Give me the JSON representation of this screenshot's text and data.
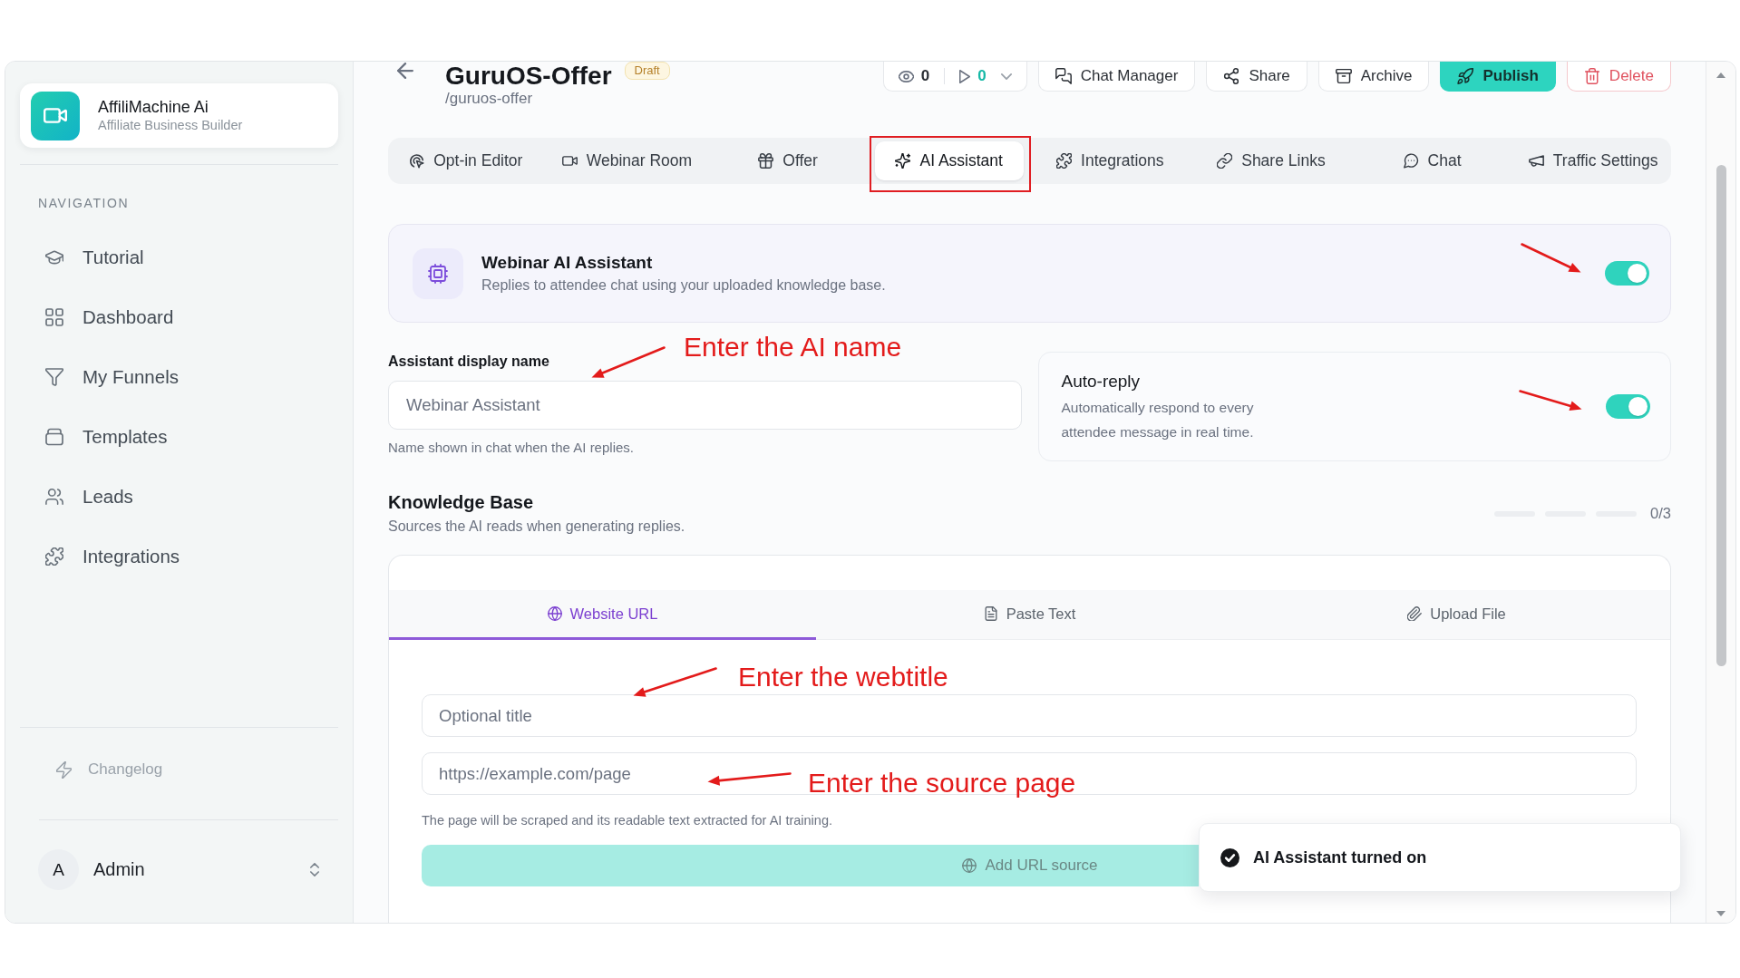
{
  "sidebar": {
    "brand": {
      "name": "AffiliMachine Ai",
      "tagline": "Affiliate Business Builder"
    },
    "section_label": "NAVIGATION",
    "items": [
      {
        "label": "Tutorial",
        "selected": false
      },
      {
        "label": "Dashboard",
        "selected": false
      },
      {
        "label": "My Funnels",
        "selected": false
      },
      {
        "label": "Templates",
        "selected": false
      },
      {
        "label": "Leads",
        "selected": false
      },
      {
        "label": "Integrations",
        "selected": false
      }
    ],
    "changelog": "Changelog",
    "user": {
      "initial": "A",
      "name": "Admin"
    }
  },
  "header": {
    "title": "GuruOS-Offer",
    "status": "Draft",
    "slug": "/guruos-offer",
    "views": "0",
    "plays": "0",
    "actions": [
      {
        "label": "Chat Manager",
        "kind": "default"
      },
      {
        "label": "Share",
        "kind": "default"
      },
      {
        "label": "Archive",
        "kind": "default"
      },
      {
        "label": "Publish",
        "kind": "primary"
      },
      {
        "label": "Delete",
        "kind": "danger"
      }
    ]
  },
  "tabs": [
    {
      "label": "Opt-in Editor",
      "selected": false,
      "highlighted": false
    },
    {
      "label": "Webinar Room",
      "selected": false,
      "highlighted": false
    },
    {
      "label": "Offer",
      "selected": false,
      "highlighted": false
    },
    {
      "label": "AI Assistant",
      "selected": true,
      "highlighted": true
    },
    {
      "label": "Integrations",
      "selected": false,
      "highlighted": false
    },
    {
      "label": "Share Links",
      "selected": false,
      "highlighted": false
    },
    {
      "label": "Chat",
      "selected": false,
      "highlighted": false
    },
    {
      "label": "Traffic Settings",
      "selected": false,
      "highlighted": false
    }
  ],
  "assistant": {
    "title": "Webinar AI Assistant",
    "description": "Replies to attendee chat using your uploaded knowledge base.",
    "on": true
  },
  "display_name": {
    "label": "Assistant display name",
    "placeholder": "Webinar Assistant",
    "hint": "Name shown in chat when the AI replies."
  },
  "auto_reply": {
    "title": "Auto-reply",
    "description": "Automatically respond to every attendee message in real time.",
    "on": true
  },
  "knowledge_base": {
    "title": "Knowledge Base",
    "subtitle": "Sources the AI reads when generating replies.",
    "slots": [
      {
        "filled": false
      },
      {
        "filled": false
      },
      {
        "filled": false
      }
    ],
    "count": "0/3",
    "source_tabs": [
      {
        "label": "Website URL",
        "selected": true
      },
      {
        "label": "Paste Text",
        "selected": false
      },
      {
        "label": "Upload File",
        "selected": false
      }
    ],
    "title_field": {
      "placeholder": "Optional title"
    },
    "url_field": {
      "placeholder": "https://example.com/page"
    },
    "hint": "The page will be scraped and its readable text extracted for AI training.",
    "add_button": {
      "label": "Add URL source",
      "disabled": true
    }
  },
  "toast": {
    "message": "AI Assistant turned on"
  },
  "annotations": [
    {
      "text": "Enter the AI name"
    },
    {
      "text": "Enter the webtitle"
    },
    {
      "text": "Enter the source page"
    }
  ]
}
